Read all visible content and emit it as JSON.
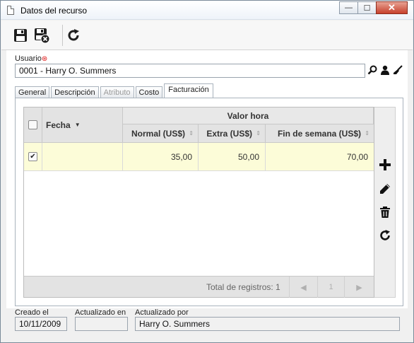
{
  "window": {
    "title": "Datos del recurso",
    "minimize_label": "—",
    "maximize_label": "☐",
    "close_label": "✕"
  },
  "toolbar": {
    "buttons": [
      {
        "name": "save",
        "icon": "floppy-disk-icon"
      },
      {
        "name": "save-and-close",
        "icon": "floppy-disk-close-icon"
      },
      {
        "name": "refresh",
        "icon": "refresh-icon"
      }
    ]
  },
  "user": {
    "label": "Usuario",
    "required_mark": "⊛",
    "value": "0001 - Harry O. Summers"
  },
  "tabs": [
    {
      "label": "General",
      "state": "normal"
    },
    {
      "label": "Descripción",
      "state": "normal"
    },
    {
      "label": "Atributo",
      "state": "disabled"
    },
    {
      "label": "Costo",
      "state": "normal"
    },
    {
      "label": "Facturación",
      "state": "active"
    }
  ],
  "grid": {
    "group_header": "Valor hora",
    "columns": {
      "fecha": "Fecha",
      "normal": "Normal (US$)",
      "extra": "Extra (US$)",
      "weekend": "Fin de semana (US$)"
    },
    "rows": [
      {
        "checked": true,
        "fecha": "",
        "normal": "35,00",
        "extra": "50,00",
        "weekend": "70,00"
      }
    ],
    "footer_text": "Total de registros: 1",
    "pager": {
      "prev": "◀",
      "page": "1",
      "next": "▶"
    }
  },
  "side_actions": [
    "add-icon",
    "edit-pencil-icon",
    "delete-trash-icon",
    "refresh-icon"
  ],
  "meta": {
    "created_label": "Creado el",
    "created_value": "10/11/2009",
    "updated_on_label": "Actualizado en",
    "updated_on_value": "",
    "updated_by_label": "Actualizado por",
    "updated_by_value": "Harry O. Summers"
  },
  "colors": {
    "selected_row": "#fcfcd8",
    "header_bg": "#e3e3e3",
    "required": "#dd1111"
  }
}
